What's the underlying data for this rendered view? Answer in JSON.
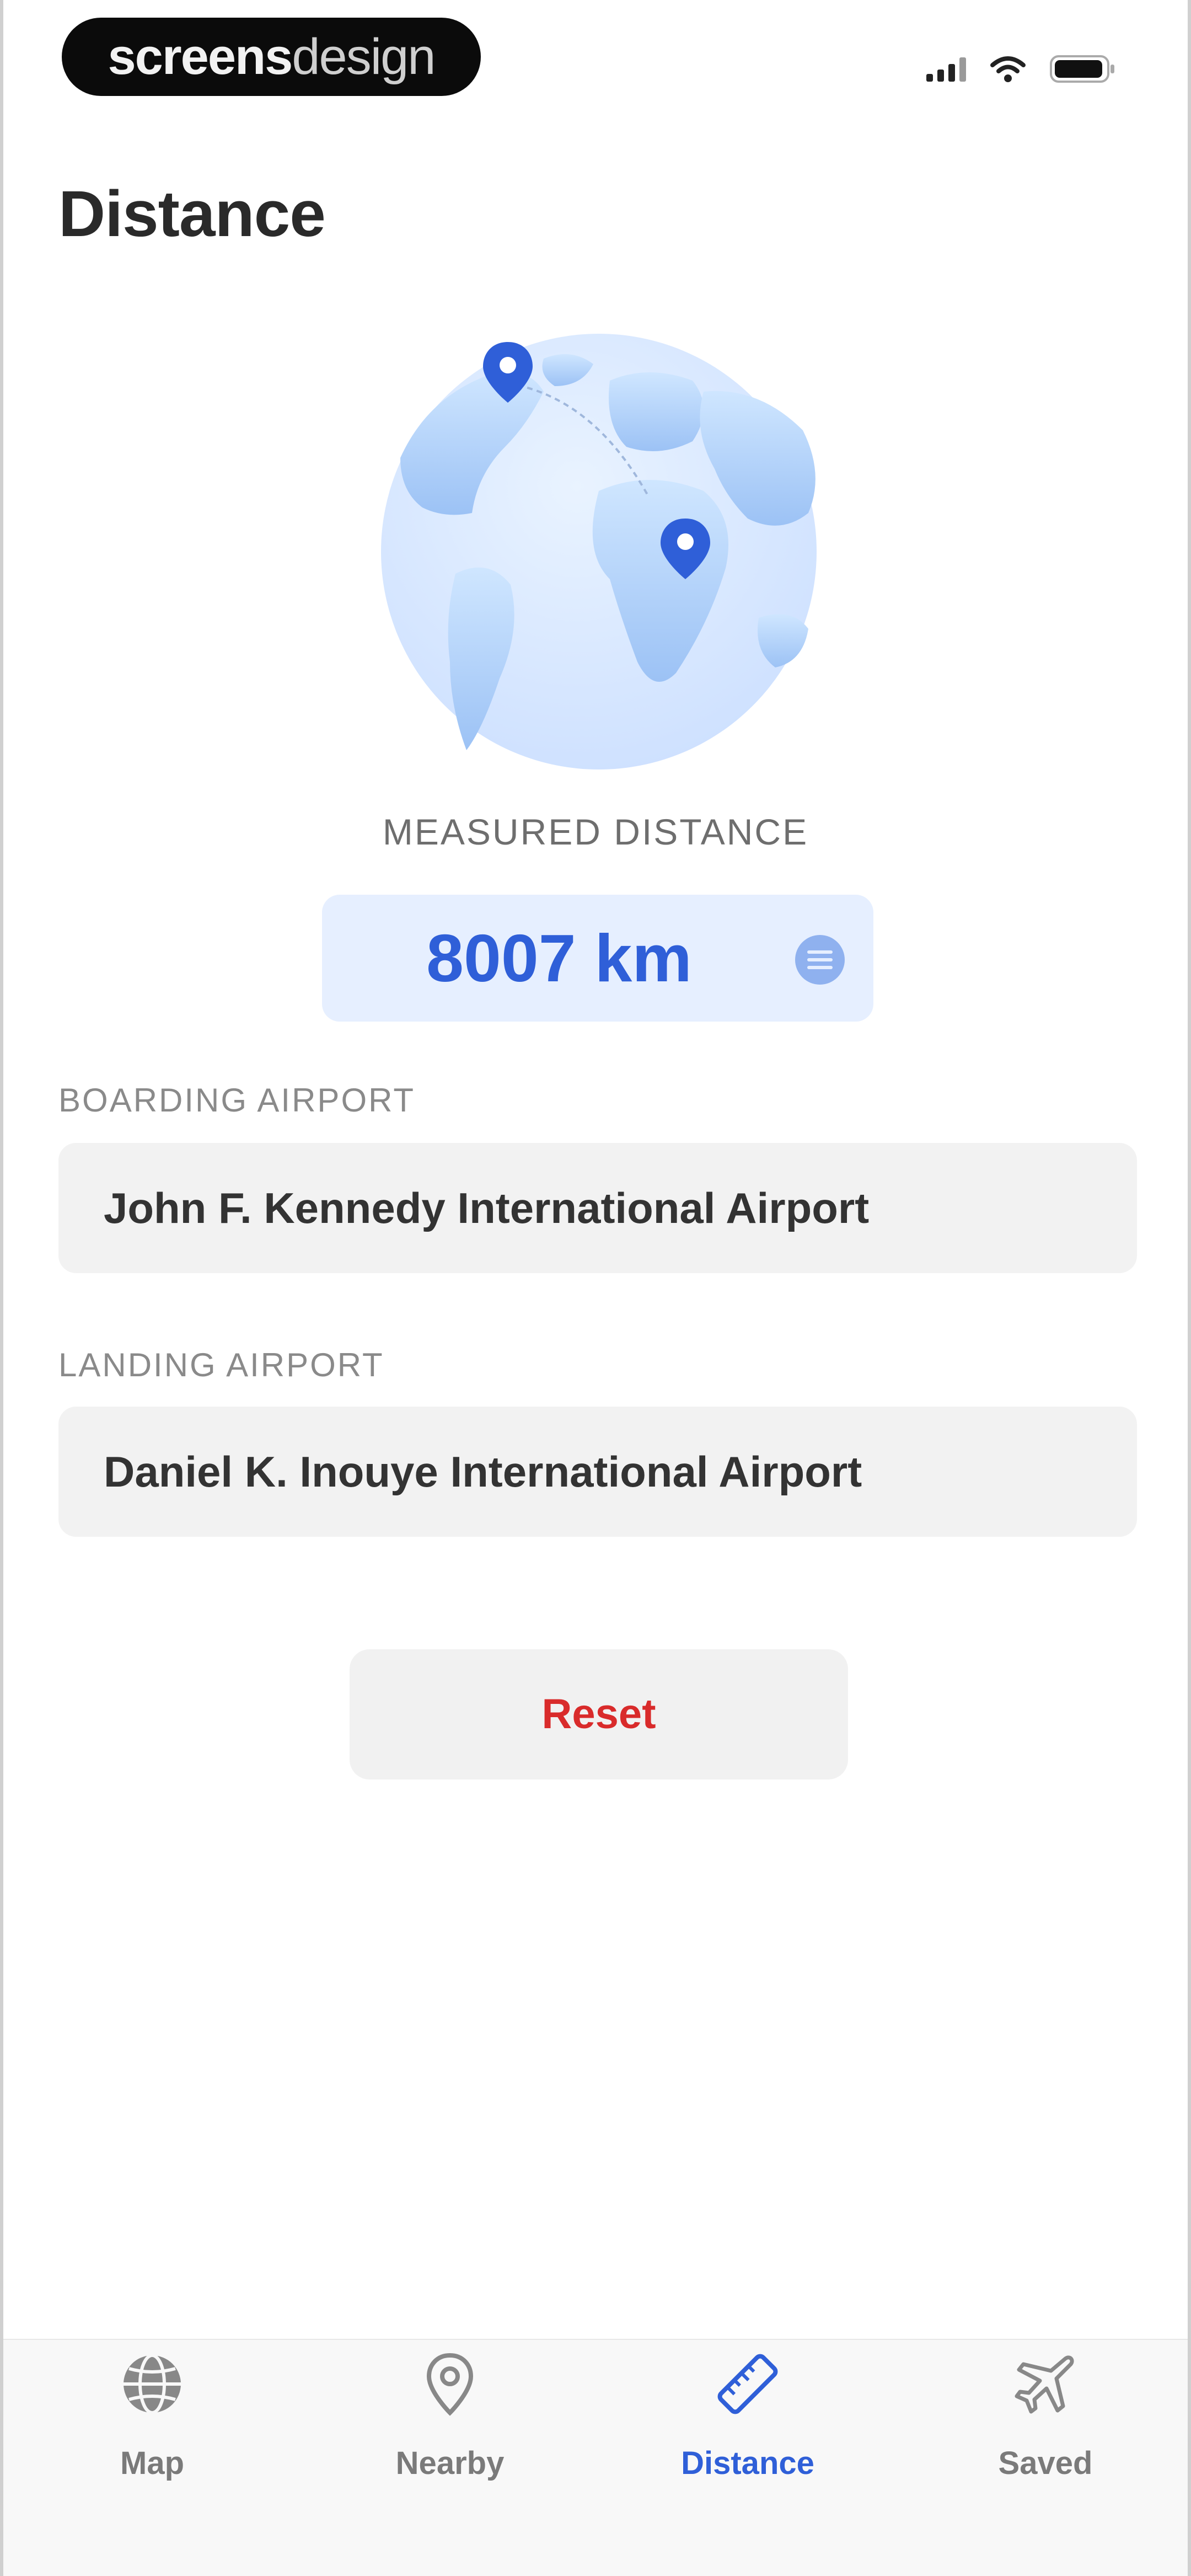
{
  "status_bar": {
    "brand_bold": "screens",
    "brand_light": "design"
  },
  "page": {
    "title": "Distance"
  },
  "distance": {
    "label": "MEASURED DISTANCE",
    "value": "8007 km"
  },
  "boarding": {
    "label": "BOARDING AIRPORT",
    "value": "John F. Kennedy International Airport"
  },
  "landing": {
    "label": "LANDING AIRPORT",
    "value": "Daniel K. Inouye International Airport"
  },
  "actions": {
    "reset_label": "Reset"
  },
  "tab_bar": {
    "tabs": [
      {
        "label": "Map",
        "icon": "globe-icon",
        "active": false
      },
      {
        "label": "Nearby",
        "icon": "location-pin-icon",
        "active": false
      },
      {
        "label": "Distance",
        "icon": "ruler-icon",
        "active": true
      },
      {
        "label": "Saved",
        "icon": "airplane-icon",
        "active": false
      }
    ]
  },
  "colors": {
    "accent": "#2f5fd8",
    "distance_bg": "#e6efff",
    "reset_text": "#d92b2b",
    "field_bg": "#f2f2f2"
  }
}
